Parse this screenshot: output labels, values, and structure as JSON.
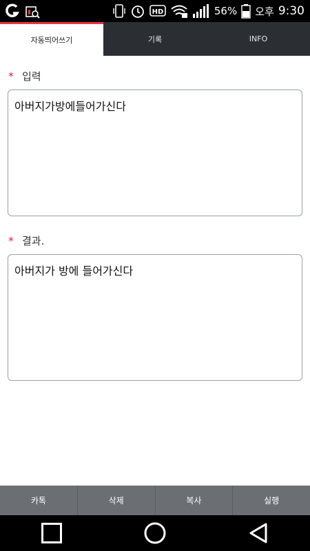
{
  "status_bar": {
    "battery_percent": "56%",
    "ampm": "오후",
    "time": "9:30",
    "icons": [
      "g-logo-icon",
      "search-app-icon",
      "vibrate-icon",
      "alarm-icon",
      "hd-icon",
      "wifi-icon",
      "signal-icon",
      "battery-icon"
    ]
  },
  "tabs": [
    {
      "label": "자동띄어쓰기",
      "active": true
    },
    {
      "label": "기록",
      "active": false
    },
    {
      "label": "INFO",
      "active": false
    }
  ],
  "input_section": {
    "required_mark": "*",
    "label": "입력",
    "value": "아버지가방에들어가신다"
  },
  "result_section": {
    "required_mark": "*",
    "label": "결과.",
    "value": "아버지가 방에 들어가신다"
  },
  "bottom_buttons": [
    "카톡",
    "삭제",
    "복사",
    "실행"
  ],
  "nav": {
    "icons": [
      "recent-apps-icon",
      "home-icon",
      "back-icon"
    ]
  },
  "colors": {
    "accent": "#e8343f",
    "tab_bar": "#2b2f33",
    "bottom_bar": "#6b6f73"
  }
}
